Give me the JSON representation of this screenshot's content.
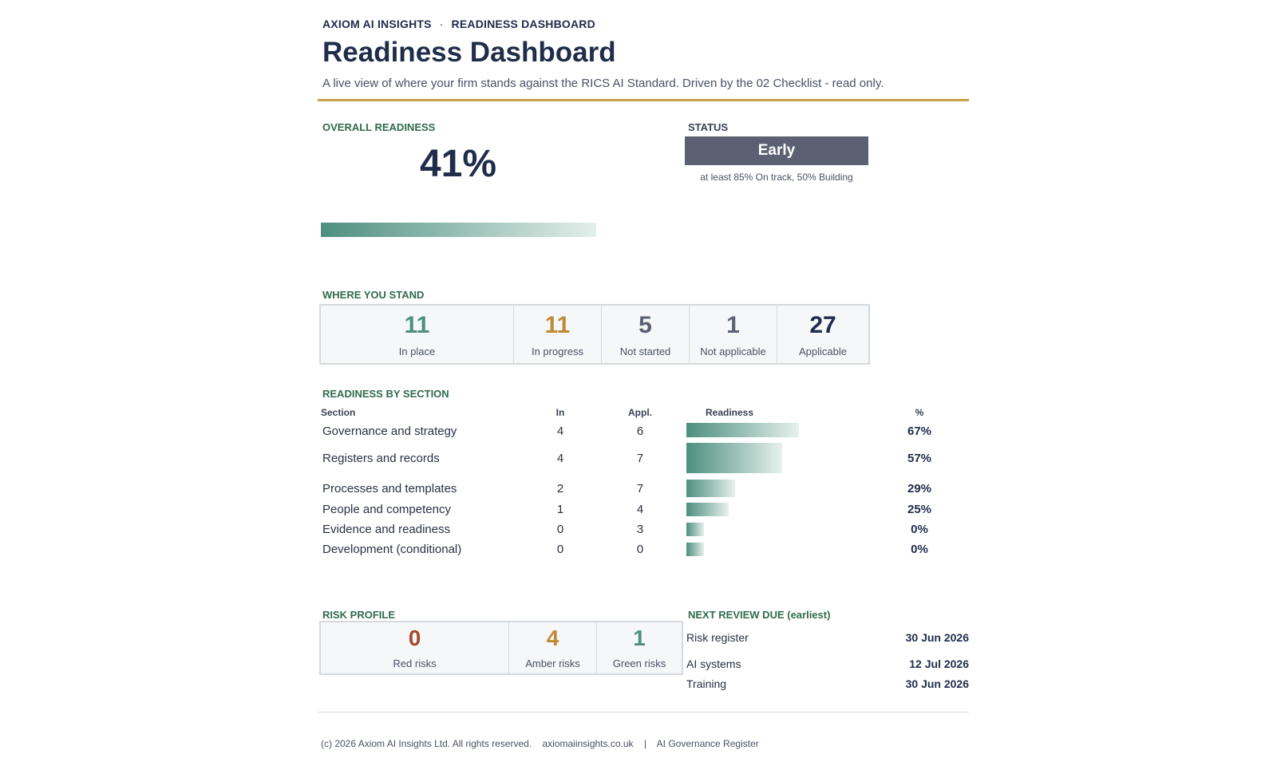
{
  "header": {
    "brand": "AXIOM AI INSIGHTS",
    "separator": "·",
    "crumb": "READINESS DASHBOARD",
    "title": "Readiness Dashboard",
    "subtitle": "A live view of where your firm stands against the RICS AI Standard. Driven by the 02 Checklist - read only."
  },
  "overall": {
    "label": "OVERALL READINESS",
    "value": "41%",
    "progress": 0.41
  },
  "status": {
    "label": "STATUS",
    "value": "Early",
    "note": "at least 85% On track, 50% Building"
  },
  "where": {
    "label": "WHERE YOU STAND",
    "stats": [
      {
        "value": "11",
        "label": "In place",
        "color": "#4e8f80"
      },
      {
        "value": "11",
        "label": "In progress",
        "color": "#c08a35"
      },
      {
        "value": "5",
        "label": "Not started",
        "color": "#5b6173"
      },
      {
        "value": "1",
        "label": "Not applicable",
        "color": "#5b6173"
      },
      {
        "value": "27",
        "label": "Applicable",
        "color": "#1f2d4a"
      }
    ]
  },
  "sections": {
    "label": "READINESS BY SECTION",
    "headers": {
      "section": "Section",
      "in": "In",
      "appl": "Appl.",
      "readiness": "Readiness",
      "pct": "%"
    },
    "rows": [
      {
        "name": "Governance and strategy",
        "in": "4",
        "appl": "6",
        "pct": "67%",
        "readiness": 0.67
      },
      {
        "name": "Registers and records",
        "in": "4",
        "appl": "7",
        "pct": "57%",
        "readiness": 0.57
      },
      {
        "name": "Processes and templates",
        "in": "2",
        "appl": "7",
        "pct": "29%",
        "readiness": 0.29
      },
      {
        "name": "People and competency",
        "in": "1",
        "appl": "4",
        "pct": "25%",
        "readiness": 0.25
      },
      {
        "name": "Evidence and readiness",
        "in": "0",
        "appl": "3",
        "pct": "0%",
        "readiness": 0
      },
      {
        "name": "Development (conditional)",
        "in": "0",
        "appl": "0",
        "pct": "0%",
        "readiness": 0
      }
    ]
  },
  "risk": {
    "label": "RISK PROFILE",
    "stats": [
      {
        "value": "0",
        "label": "Red risks",
        "color": "#a64a2e"
      },
      {
        "value": "4",
        "label": "Amber risks",
        "color": "#c08a35"
      },
      {
        "value": "1",
        "label": "Green risks",
        "color": "#4e8f80"
      }
    ]
  },
  "review": {
    "label": "NEXT REVIEW DUE (earliest)",
    "items": [
      {
        "name": "Risk register",
        "date": "30 Jun 2026"
      },
      {
        "name": "AI systems",
        "date": "12 Jul 2026"
      },
      {
        "name": "Training",
        "date": "30 Jun 2026"
      }
    ]
  },
  "footer": {
    "copyright": "(c) 2026 Axiom AI Insights Ltd. All rights reserved.",
    "site": "axiomaiinsights.co.uk",
    "pipe": "|",
    "product": "AI Governance Register"
  }
}
